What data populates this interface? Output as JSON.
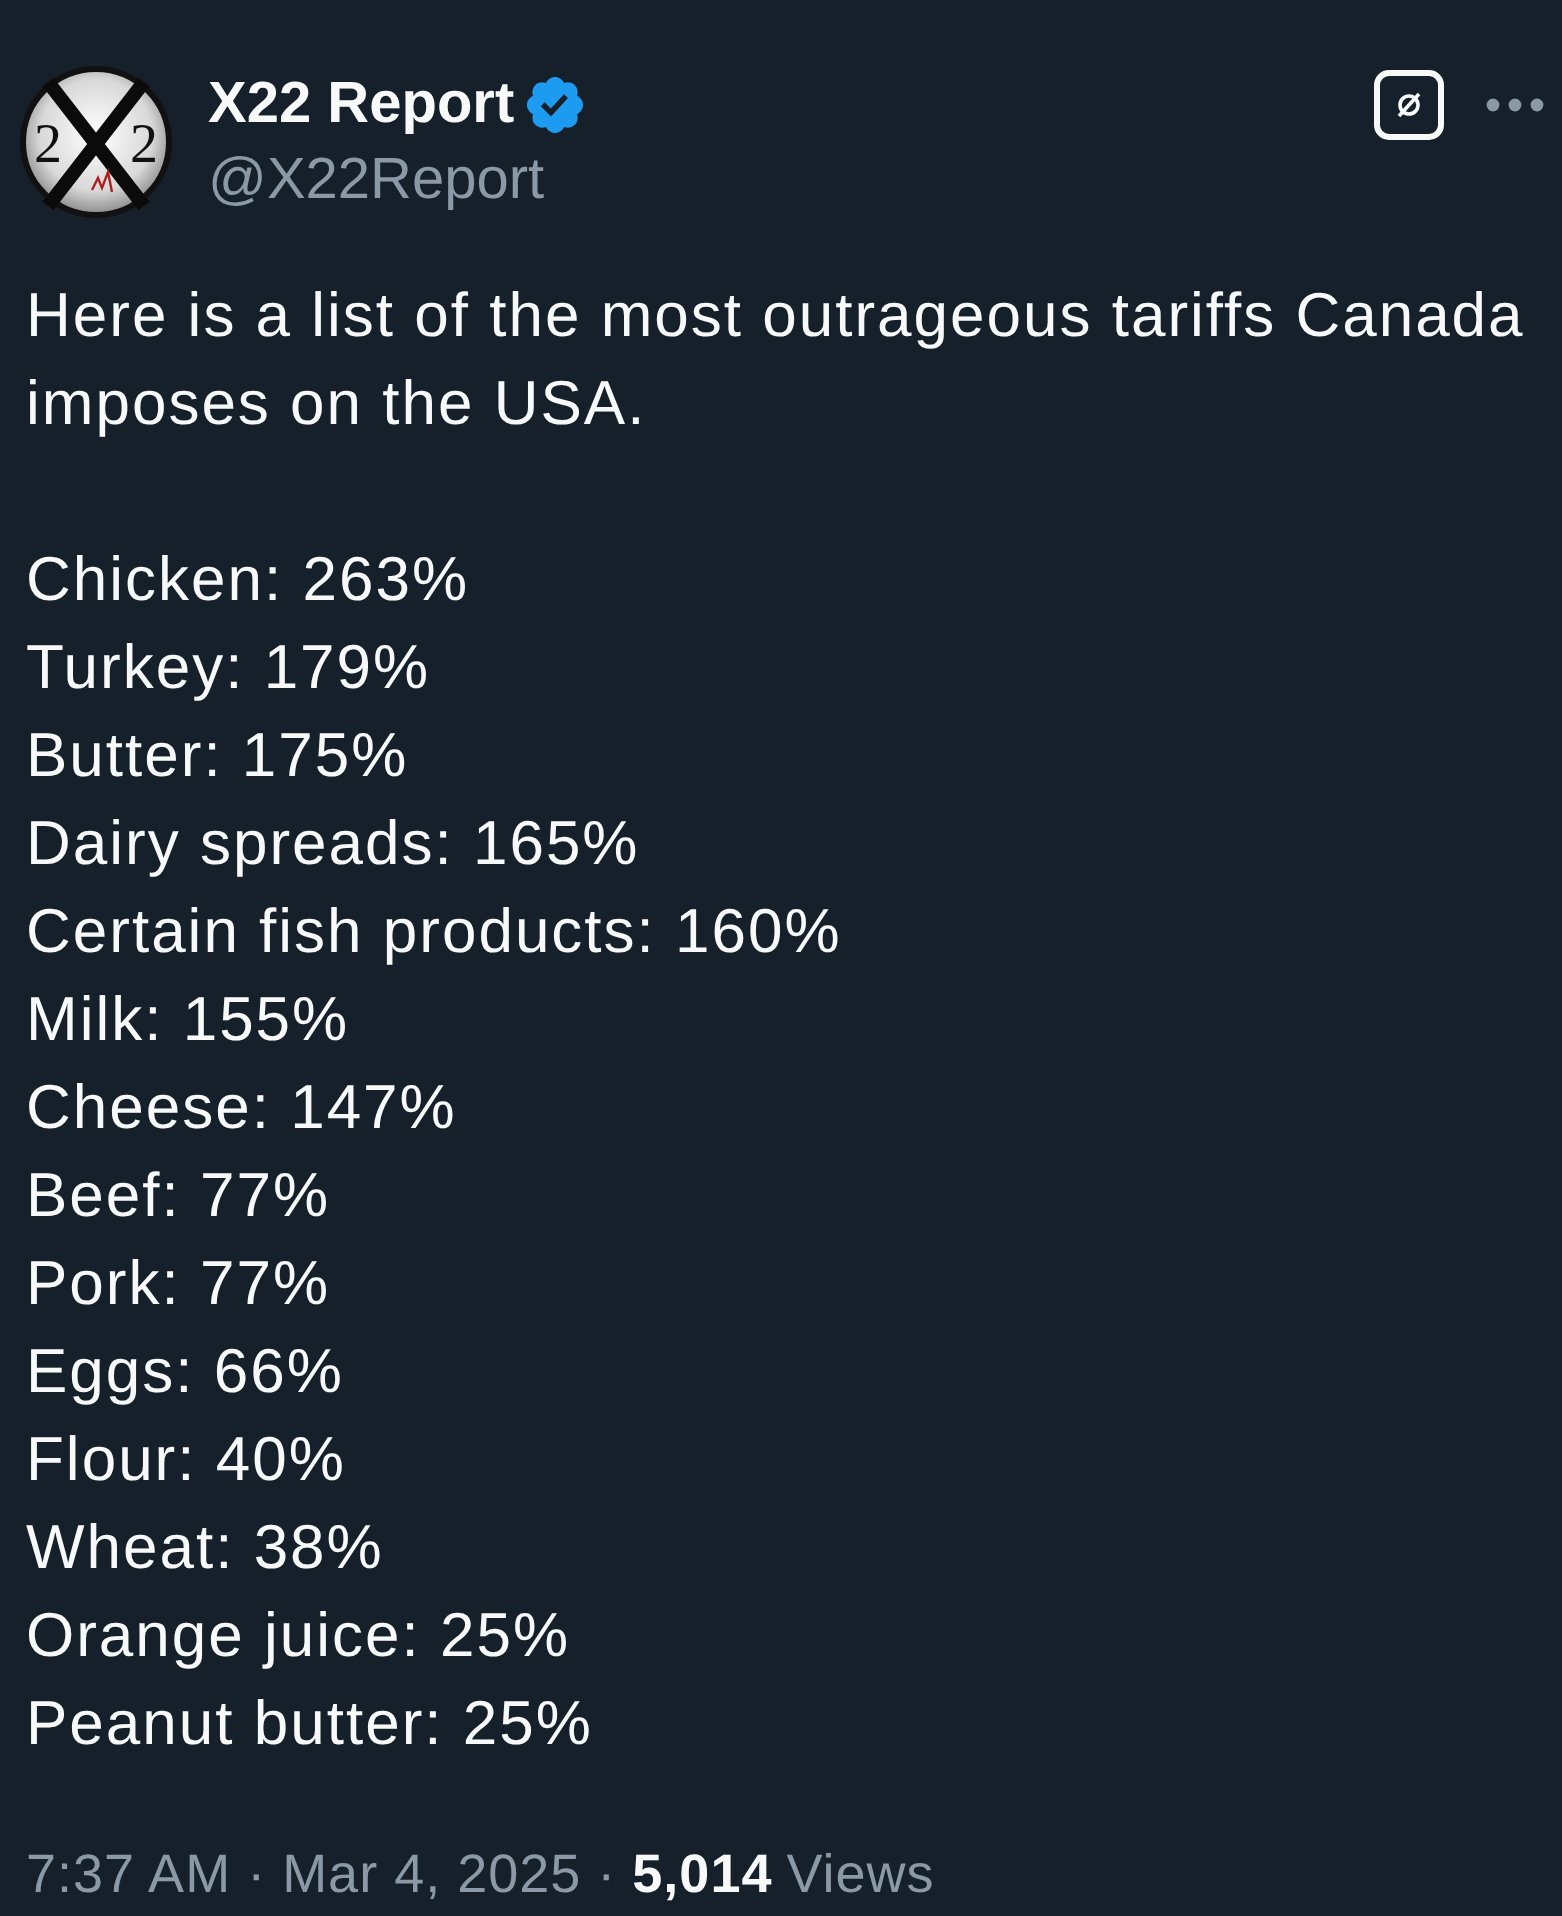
{
  "author": {
    "avatar": {
      "digits": [
        "2",
        "2"
      ]
    },
    "name": "X22 Report",
    "verified": true,
    "handle": "@X22Report"
  },
  "post": {
    "intro": "Here is a list of the most outrageous tariffs Canada imposes on the USA.",
    "items": [
      "Chicken: 263%",
      "Turkey: 179%",
      "Butter: 175%",
      "Dairy spreads: 165%",
      "Certain fish products: 160%",
      "Milk: 155%",
      "Cheese: 147%",
      "Beef: 77%",
      "Pork: 77%",
      "Eggs: 66%",
      "Flour: 40%",
      "Wheat: 38%",
      "Orange juice: 25%",
      "Peanut butter: 25%"
    ]
  },
  "meta": [
    {
      "kind": "text",
      "text": "7:37 AM"
    },
    {
      "kind": "separator",
      "text": "·"
    },
    {
      "kind": "text",
      "text": "Mar 4, 2025"
    },
    {
      "kind": "separator",
      "text": "·"
    },
    {
      "kind": "count",
      "text": "5,014"
    },
    {
      "kind": "text",
      "text": "Views"
    }
  ]
}
